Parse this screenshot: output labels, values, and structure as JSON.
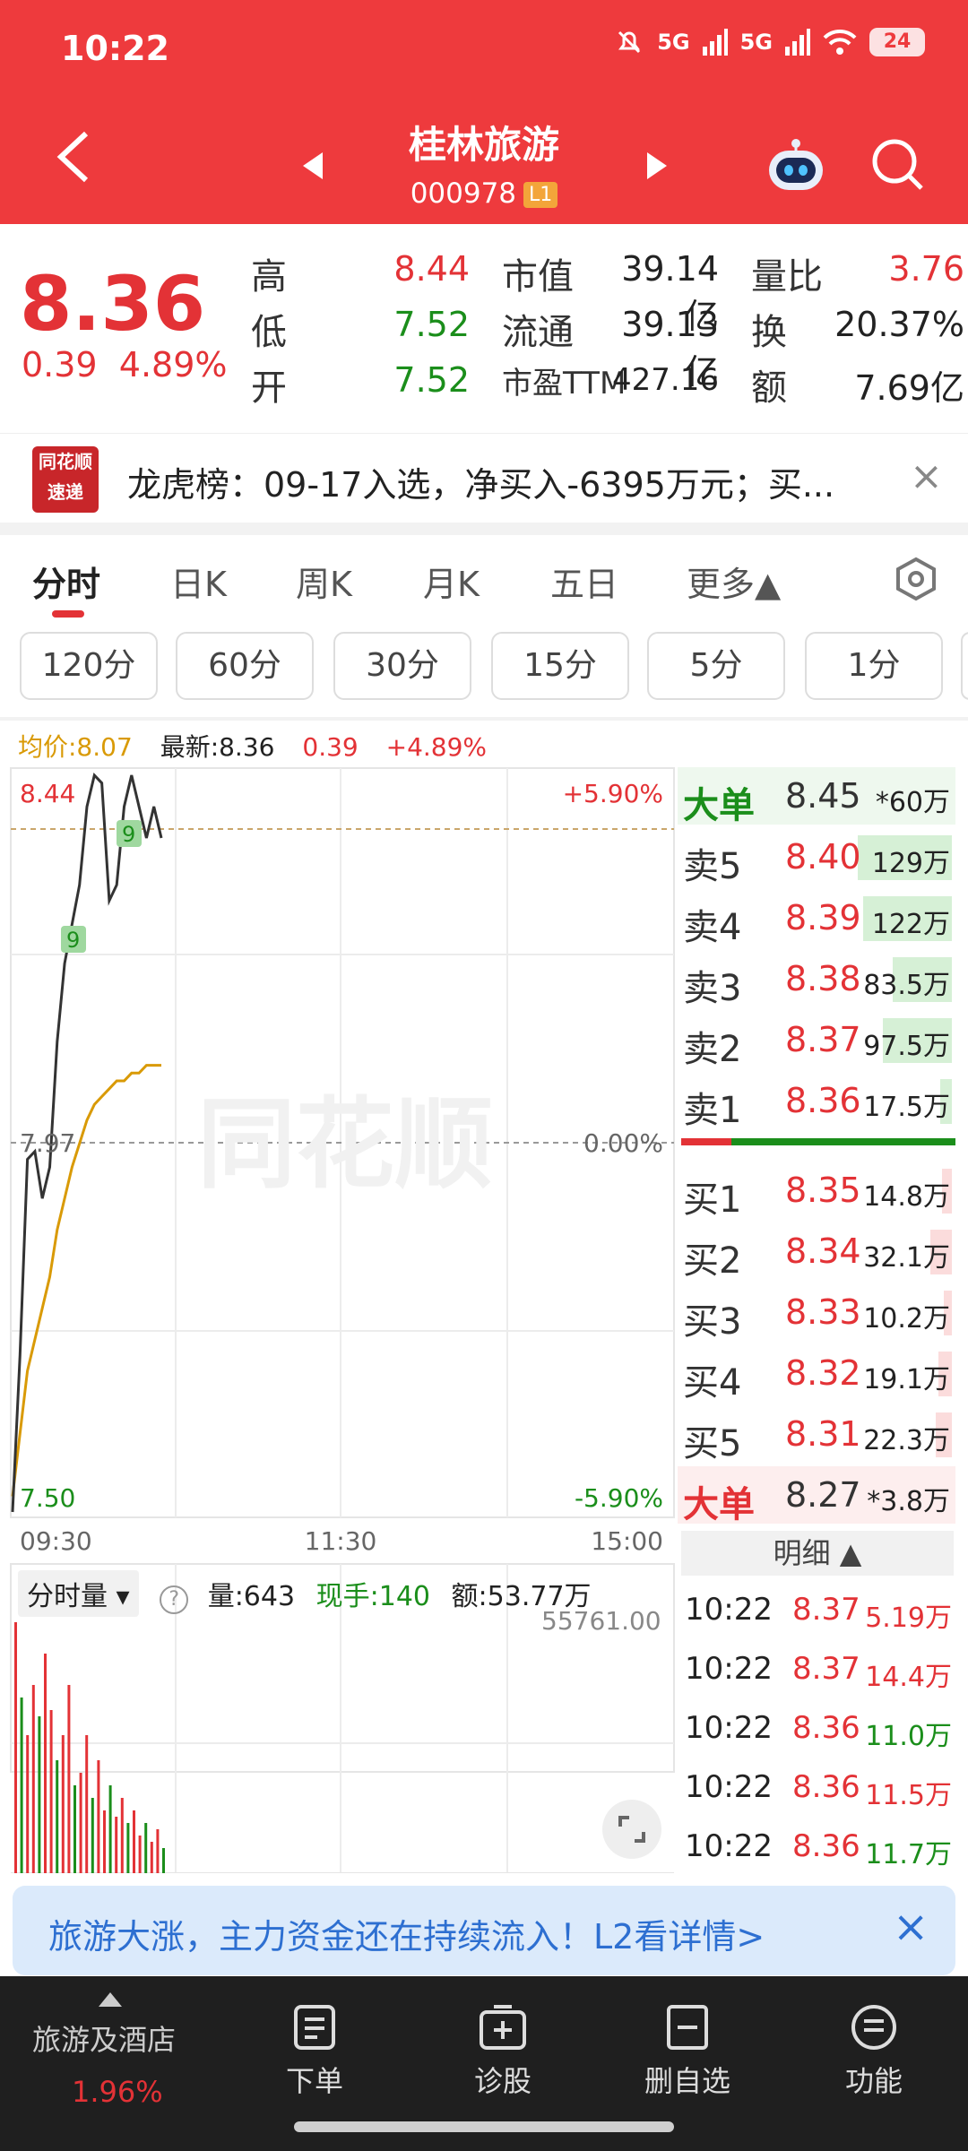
{
  "status": {
    "time": "10:22",
    "signal1": "5G",
    "signal2": "5G",
    "battery": "24"
  },
  "header": {
    "title": "桂林旅游",
    "code": "000978",
    "level": "L1"
  },
  "quote": {
    "price": "8.36",
    "change": "0.39",
    "change_pct": "4.89%",
    "high_label": "高",
    "high": "8.44",
    "low_label": "低",
    "low": "7.52",
    "open_label": "开",
    "open": "7.52",
    "mcap_label": "市值",
    "mcap": "39.14亿",
    "float_label": "流通",
    "float": "39.13亿",
    "pe_label": "市盈TTM",
    "pe": "427.16",
    "vr_label": "量比",
    "vr": "3.76",
    "turn_label": "换",
    "turn": "20.37%",
    "amt_label": "额",
    "amt": "7.69亿"
  },
  "banner": {
    "logo_line1": "同花顺",
    "logo_line2": "速递",
    "text": "龙虎榜：09-17入选，净买入-6395万元；买..."
  },
  "tabs": [
    "分时",
    "日K",
    "周K",
    "月K",
    "五日",
    "更多▲"
  ],
  "periods": [
    "120分",
    "60分",
    "30分",
    "15分",
    "5分",
    "1分"
  ],
  "info": {
    "avg": "均价:8.07",
    "latest": "最新:8.36",
    "chg": "0.39",
    "pct": "+4.89%"
  },
  "chart_labels": {
    "top_price": "8.44",
    "mid_price": "7.97",
    "bottom_price": "7.50",
    "top_pct": "+5.90%",
    "mid_pct": "0.00%",
    "bottom_pct": "-5.90%",
    "t_start": "09:30",
    "t_mid": "11:30",
    "t_end": "15:00",
    "watermark": "同花顺",
    "marker": "9"
  },
  "chart_data": {
    "type": "line",
    "ylim": [
      7.5,
      8.44
    ],
    "series": [
      {
        "values": [
          7.5,
          7.7,
          7.95,
          7.96,
          7.9,
          7.94,
          8.1,
          8.2,
          8.25,
          8.3,
          8.4,
          8.44,
          8.43,
          8.28,
          8.3,
          8.4,
          8.44,
          8.4,
          8.36,
          8.4,
          8.36
        ]
      },
      {
        "values": [
          7.52,
          7.6,
          7.68,
          7.72,
          7.76,
          7.8,
          7.86,
          7.9,
          7.94,
          7.97,
          8.0,
          8.02,
          8.03,
          8.04,
          8.05,
          8.05,
          8.06,
          8.06,
          8.07,
          8.07,
          8.07
        ]
      }
    ],
    "volume": [
      40,
      28,
      22,
      30,
      25,
      35,
      26,
      18,
      22,
      30,
      14,
      16,
      22,
      12,
      18,
      10,
      14,
      9,
      12,
      8,
      10,
      6,
      8,
      5,
      7,
      4
    ]
  },
  "orderbook": {
    "big_sell": {
      "label": "大单",
      "price": "8.45",
      "vol": "*60万"
    },
    "asks": [
      {
        "label": "卖5",
        "price": "8.40",
        "vol": "129万",
        "ratio": 0.95
      },
      {
        "label": "卖4",
        "price": "8.39",
        "vol": "122万",
        "ratio": 0.9
      },
      {
        "label": "卖3",
        "price": "8.38",
        "vol": "83.5万",
        "ratio": 0.6
      },
      {
        "label": "卖2",
        "price": "8.37",
        "vol": "97.5万",
        "ratio": 0.7
      },
      {
        "label": "卖1",
        "price": "8.36",
        "vol": "17.5万",
        "ratio": 0.12
      }
    ],
    "bids": [
      {
        "label": "买1",
        "price": "8.35",
        "vol": "14.8万",
        "ratio": 0.1
      },
      {
        "label": "买2",
        "price": "8.34",
        "vol": "32.1万",
        "ratio": 0.22
      },
      {
        "label": "买3",
        "price": "8.33",
        "vol": "10.2万",
        "ratio": 0.08
      },
      {
        "label": "买4",
        "price": "8.32",
        "vol": "19.1万",
        "ratio": 0.14
      },
      {
        "label": "买5",
        "price": "8.31",
        "vol": "22.3万",
        "ratio": 0.16
      }
    ],
    "big_buy": {
      "label": "大单",
      "price": "8.27",
      "vol": "*3.8万"
    }
  },
  "detail": {
    "title": "明细 ▲",
    "rows": [
      {
        "time": "10:22",
        "price": "8.37",
        "vol": "5.19万",
        "color": "red"
      },
      {
        "time": "10:22",
        "price": "8.37",
        "vol": "14.4万",
        "color": "red"
      },
      {
        "time": "10:22",
        "price": "8.36",
        "vol": "11.0万",
        "color": "green"
      },
      {
        "time": "10:22",
        "price": "8.36",
        "vol": "11.5万",
        "color": "red"
      },
      {
        "time": "10:22",
        "price": "8.36",
        "vol": "11.7万",
        "color": "green"
      }
    ]
  },
  "volume_head": {
    "dropdown": "分时量 ▾",
    "vol": "量:643",
    "now": "现手:140",
    "amt": "额:53.77万",
    "max": "55761.00"
  },
  "promo": {
    "text": "旅游大涨，主力资金还在持续流入！L2看详情>"
  },
  "bottom_nav": {
    "sector": "旅游及酒店",
    "sector_pct": "1.96%",
    "order": "下单",
    "diagnose": "诊股",
    "remove": "删自选",
    "func": "功能"
  },
  "colors": {
    "header": "#ee3a3d",
    "up": "#e33236",
    "down": "#1b8e1b",
    "avg": "#d99a06"
  }
}
